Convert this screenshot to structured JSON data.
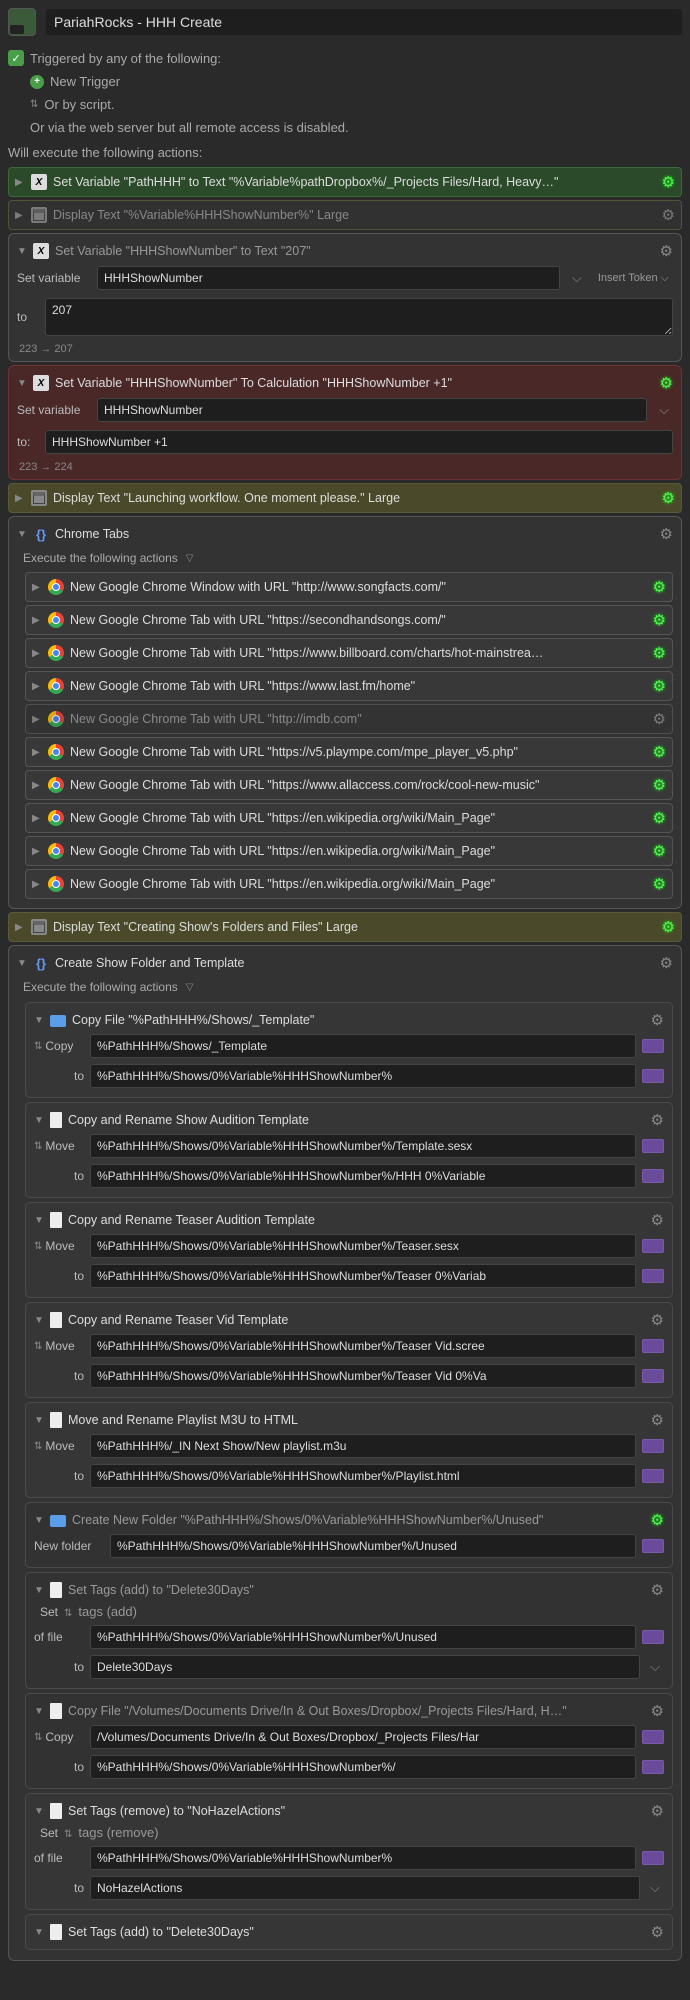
{
  "header": {
    "title": "PariahRocks - HHH Create"
  },
  "trigger": {
    "text": "Triggered by any of the following:",
    "new_trigger": "New Trigger",
    "or_script": "Or by script.",
    "web_server": "Or via the web server but all remote access is disabled."
  },
  "exec_label": "Will execute the following actions:",
  "a_pathhhh": "Set Variable \"PathHHH\" to Text \"%Variable%pathDropbox%/_Projects Files/Hard, Heavy…\"",
  "a_display_shownum": "Display Text \"%Variable%HHHShowNumber%\" Large",
  "a_setvar207": {
    "title": "Set Variable \"HHHShowNumber\" to Text \"207\"",
    "label_setvar": "Set variable",
    "var": "HHHShowNumber",
    "insert_token": "Insert Token",
    "to_label": "to",
    "to_val": "207",
    "footer_from": "223",
    "footer_to": "207"
  },
  "a_setvar_calc": {
    "title": "Set Variable \"HHHShowNumber\" To Calculation \"HHHShowNumber +1\"",
    "label_setvar": "Set variable",
    "var": "HHHShowNumber",
    "to_label": "to:",
    "to_val": "HHHShowNumber +1",
    "footer_from": "223",
    "footer_to": "224"
  },
  "a_display_launch": "Display Text \"Launching workflow. One moment please.\" Large",
  "chrome": {
    "title": "Chrome Tabs",
    "exec": "Execute the following actions",
    "tabs": [
      "New Google Chrome Window with URL \"http://www.songfacts.com/\"",
      "New Google Chrome Tab with URL \"https://secondhandsongs.com/\"",
      "New Google Chrome Tab with URL \"https://www.billboard.com/charts/hot-mainstrea…",
      "New Google Chrome Tab with URL \"https://www.last.fm/home\"",
      "New Google Chrome Tab with URL \"http://imdb.com\"",
      "New Google Chrome Tab with URL \"https://v5.plaympe.com/mpe_player_v5.php\"",
      "New Google Chrome Tab with URL \"https://www.allaccess.com/rock/cool-new-music\"",
      "New Google Chrome Tab with URL \"https://en.wikipedia.org/wiki/Main_Page\"",
      "New Google Chrome Tab with URL \"https://en.wikipedia.org/wiki/Main_Page\"",
      "New Google Chrome Tab with URL \"https://en.wikipedia.org/wiki/Main_Page\""
    ],
    "dim_idx": 4
  },
  "a_display_creating": "Display Text \"Creating Show's Folders and Files\" Large",
  "folder": {
    "title": "Create Show Folder and Template",
    "exec": "Execute the following actions",
    "copy1": {
      "title": "Copy File \"%PathHHH%/Shows/_Template\"",
      "op": "Copy",
      "from": "%PathHHH%/Shows/_Template",
      "to_label": "to",
      "to": "%PathHHH%/Shows/0%Variable%HHHShowNumber%"
    },
    "move1": {
      "title": "Copy and Rename Show Audition Template",
      "op": "Move",
      "from": "%PathHHH%/Shows/0%Variable%HHHShowNumber%/Template.sesx",
      "to_label": "to",
      "to": "%PathHHH%/Shows/0%Variable%HHHShowNumber%/HHH 0%Variable"
    },
    "move2": {
      "title": "Copy and Rename Teaser Audition Template",
      "op": "Move",
      "from": "%PathHHH%/Shows/0%Variable%HHHShowNumber%/Teaser.sesx",
      "to_label": "to",
      "to": "%PathHHH%/Shows/0%Variable%HHHShowNumber%/Teaser 0%Variab"
    },
    "move3": {
      "title": "Copy and Rename Teaser Vid Template",
      "op": "Move",
      "from": "%PathHHH%/Shows/0%Variable%HHHShowNumber%/Teaser Vid.scree",
      "to_label": "to",
      "to": "%PathHHH%/Shows/0%Variable%HHHShowNumber%/Teaser Vid 0%Va"
    },
    "move4": {
      "title": "Move and Rename Playlist M3U to HTML",
      "op": "Move",
      "from": "%PathHHH%/_IN Next Show/New playlist.m3u",
      "to_label": "to",
      "to": "%PathHHH%/Shows/0%Variable%HHHShowNumber%/Playlist.html"
    },
    "newfolder": {
      "title": "Create New Folder \"%PathHHH%/Shows/0%Variable%HHHShowNumber%/Unused\"",
      "label": "New folder",
      "val": "%PathHHH%/Shows/0%Variable%HHHShowNumber%/Unused"
    },
    "tags1": {
      "title": "Set Tags (add) to \"Delete30Days\"",
      "set_label": "Set",
      "mode": "tags (add)",
      "of_file_label": "of file",
      "of_file": "%PathHHH%/Shows/0%Variable%HHHShowNumber%/Unused",
      "to_label": "to",
      "to": "Delete30Days"
    },
    "copy2": {
      "title": "Copy File \"/Volumes/Documents Drive/In & Out Boxes/Dropbox/_Projects Files/Hard, H…\"",
      "op": "Copy",
      "from": "/Volumes/Documents Drive/In & Out Boxes/Dropbox/_Projects Files/Har",
      "to_label": "to",
      "to": "%PathHHH%/Shows/0%Variable%HHHShowNumber%/"
    },
    "tags2": {
      "title": "Set Tags (remove) to \"NoHazelActions\"",
      "set_label": "Set",
      "mode": "tags (remove)",
      "of_file_label": "of file",
      "of_file": "%PathHHH%/Shows/0%Variable%HHHShowNumber%",
      "to_label": "to",
      "to": "NoHazelActions"
    },
    "tags3": {
      "title": "Set Tags (add) to \"Delete30Days\""
    }
  }
}
